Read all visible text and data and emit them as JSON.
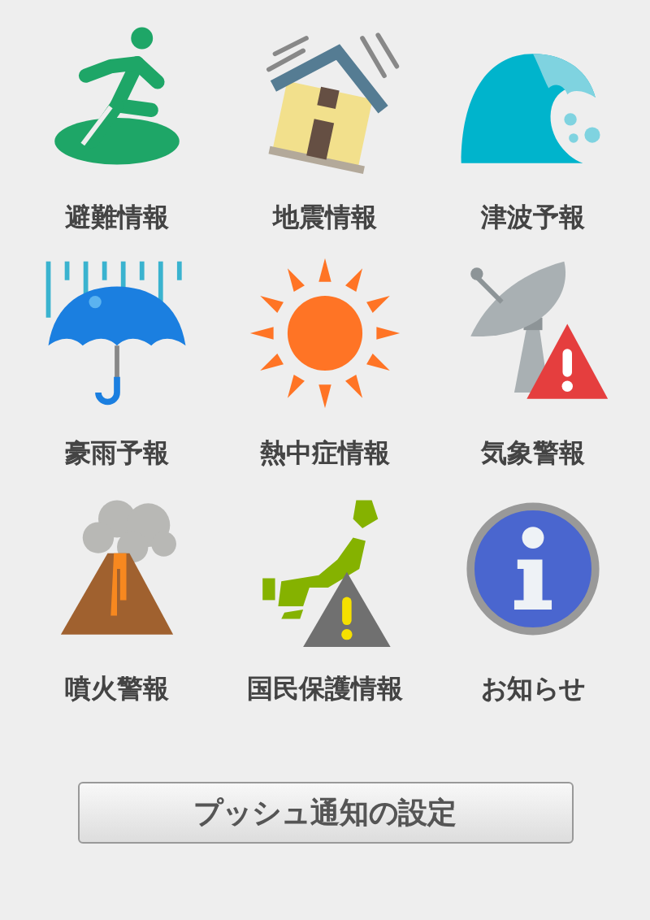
{
  "tiles": [
    {
      "kind": "evacuation",
      "label": "避難情報"
    },
    {
      "kind": "earthquake",
      "label": "地震情報"
    },
    {
      "kind": "tsunami",
      "label": "津波予報"
    },
    {
      "kind": "rain",
      "label": "豪雨予報"
    },
    {
      "kind": "heat",
      "label": "熱中症情報"
    },
    {
      "kind": "weather",
      "label": "気象警報"
    },
    {
      "kind": "volcano",
      "label": "噴火警報"
    },
    {
      "kind": "civil",
      "label": "国民保護情報"
    },
    {
      "kind": "info",
      "label": "お知らせ"
    }
  ],
  "button": "プッシュ通知の設定"
}
